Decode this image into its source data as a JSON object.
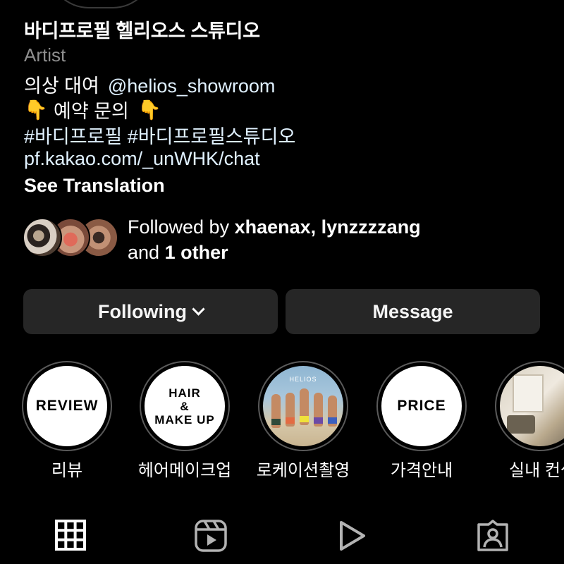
{
  "profile": {
    "name": "바디프로필 헬리오스 스튜디오",
    "category": "Artist",
    "bio_line1_text": "의상 대여",
    "bio_line1_mention": "@helios_showroom",
    "bio_line2_emoji": "👇",
    "bio_line2_text": "예약 문의",
    "bio_hashtags": "#바디프로필 #바디프로필스튜디오",
    "bio_link": "pf.kakao.com/_unWHK/chat",
    "see_translation": "See Translation"
  },
  "followed_by": {
    "prefix": "Followed by",
    "users": "xhaenax, lynzzzzang",
    "and": "and",
    "others": "1 other"
  },
  "actions": {
    "following": "Following",
    "message": "Message"
  },
  "highlights": [
    {
      "cover_text": "REVIEW",
      "label": "리뷰"
    },
    {
      "cover_text_1": "HAIR",
      "cover_text_2": "&",
      "cover_text_3": "MAKE UP",
      "label": "헤어메이크업"
    },
    {
      "cover_brand": "HELIOS",
      "label": "로케이션촬영"
    },
    {
      "cover_text": "PRICE",
      "label": "가격안내"
    },
    {
      "label": "실내 컨셉"
    }
  ],
  "tabs": [
    {
      "icon": "grid-icon",
      "active": true
    },
    {
      "icon": "reels-icon",
      "active": false
    },
    {
      "icon": "play-icon",
      "active": false
    },
    {
      "icon": "tagged-icon",
      "active": false
    }
  ]
}
